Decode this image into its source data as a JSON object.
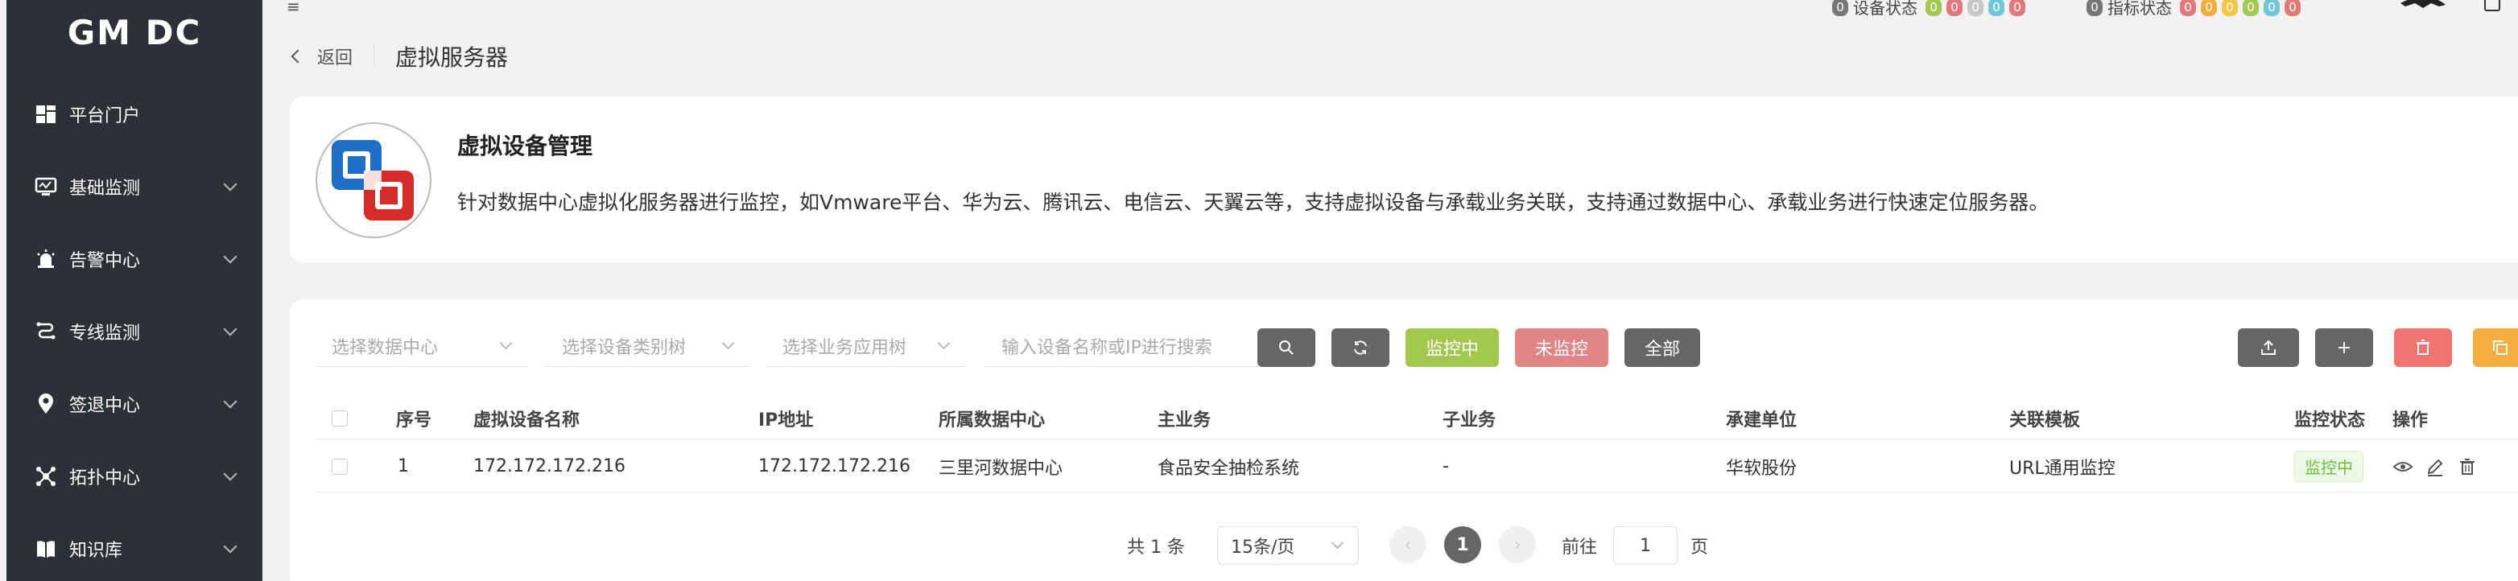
{
  "sidebar": {
    "brand": "GM DC",
    "items": [
      {
        "label": "平台门户",
        "icon": "dashboard-icon",
        "has_children": false
      },
      {
        "label": "基础监测",
        "icon": "monitor-icon",
        "has_children": true
      },
      {
        "label": "告警中心",
        "icon": "alarm-icon",
        "has_children": true
      },
      {
        "label": "专线监测",
        "icon": "line-icon",
        "has_children": true
      },
      {
        "label": "签退中心",
        "icon": "location-icon",
        "has_children": true
      },
      {
        "label": "拓扑中心",
        "icon": "topology-icon",
        "has_children": true
      },
      {
        "label": "知识库",
        "icon": "book-icon",
        "has_children": true
      }
    ]
  },
  "topbar": {
    "device_status_label": "设备状态",
    "device_status_counts": [
      "0",
      "0",
      "0",
      "0",
      "0",
      "0"
    ],
    "metric_status_label": "指标状态",
    "metric_status_counts": [
      "0",
      "0",
      "0",
      "0",
      "0",
      "0",
      "0"
    ]
  },
  "breadcrumb": {
    "back_label": "返回",
    "title": "虚拟服务器"
  },
  "intro": {
    "title": "虚拟设备管理",
    "description": "针对数据中心虚拟化服务器进行监控，如Vmware平台、华为云、腾讯云、电信云、天翼云等，支持虚拟设备与承载业务关联，支持通过数据中心、承载业务进行快速定位服务器。"
  },
  "filters": {
    "datacenter_placeholder": "选择数据中心",
    "device_type_placeholder": "选择设备类别树",
    "business_placeholder": "选择业务应用树",
    "search_placeholder": "输入设备名称或IP进行搜索"
  },
  "buttons": {
    "monitoring": "监控中",
    "not_monitoring": "未监控",
    "all": "全部"
  },
  "table": {
    "columns": [
      "序号",
      "虚拟设备名称",
      "IP地址",
      "所属数据中心",
      "主业务",
      "子业务",
      "承建单位",
      "关联模板",
      "监控状态",
      "操作"
    ],
    "rows": [
      {
        "index": "1",
        "name": "172.172.172.216",
        "ip": "172.172.172.216",
        "datacenter": "三里河数据中心",
        "main_business": "食品安全抽检系统",
        "sub_business": "-",
        "contractor": "华软股份",
        "template": "URL通用监控",
        "status": "监控中"
      }
    ]
  },
  "pagination": {
    "total": "共 1 条",
    "page_size": "15条/页",
    "current_page": "1",
    "goto_label": "前往",
    "goto_value": "1",
    "page_suffix": "页"
  },
  "colors": {
    "sidebar_bg": "#2e3038",
    "monitoring_btn": "#a3c84f",
    "not_monitoring_btn": "#e08484",
    "dark_btn": "#666666",
    "delete_btn": "#f07470",
    "export_btn": "#f5ad3f",
    "status_green": "#67c23a"
  }
}
